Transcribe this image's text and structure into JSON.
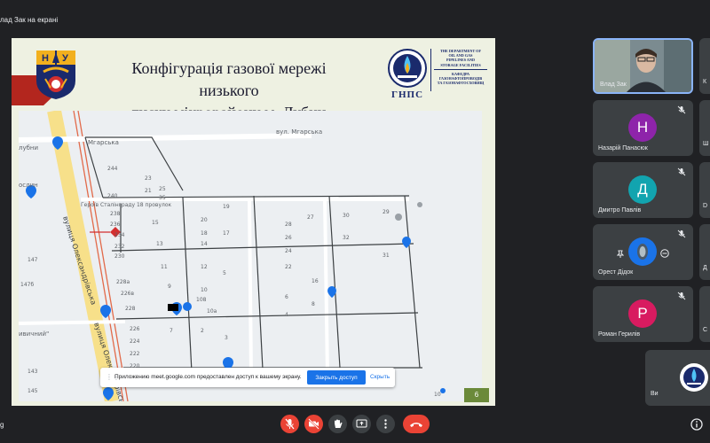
{
  "window": {
    "top_caption": "лад Зак на екрані",
    "bottom_left_text": "g"
  },
  "slide": {
    "title_line1": "Конфігурація газової мережі  низького",
    "title_line2": "тиску мікрорайону м. Лубни",
    "logo_right_label": "ГНПС",
    "dept_lines_en": [
      "THE DEPARTMENT OF",
      "OIL AND GAS",
      "PIPELINES AND",
      "STORAGE FACILITIES"
    ],
    "dept_lines_ua": [
      "КАФЕДРА",
      "ГАЗОНАФТОПРОВОДІВ",
      "ТА ГАЗОНАФТОСХОВИЩ"
    ],
    "page_number": "6",
    "map": {
      "street_mhar_top": "вул. Мгарська",
      "street_mhar_left": "Мгарська",
      "street_olek_1": "вулиця Олександрівська",
      "street_olek_2": "вулиця Олександрівська",
      "street_small": "Героїв Сталінграду 18 провулок",
      "place_lubny": "лубни",
      "place_roslyn": "ослин",
      "place_shop": "ивичний\"",
      "house_numbers": {
        "n244": "244",
        "n240": "240",
        "n238": "238",
        "n236": "236",
        "n234": "234",
        "n232": "232",
        "n230": "230",
        "n228a": "228а",
        "n226b": "226в",
        "n228": "228",
        "n226": "226",
        "n224": "224",
        "n222": "222",
        "n220": "220",
        "n218": "218",
        "n147": "147",
        "n147b": "147б",
        "n145": "145",
        "n143": "143",
        "n23": "23",
        "n21": "21",
        "n25": "25",
        "n35": "35",
        "n15": "15",
        "n13": "13",
        "n11": "11",
        "n9": "9",
        "n7": "7",
        "n20": "20",
        "n19": "19",
        "n18": "18",
        "n17": "17",
        "n14": "14",
        "n12": "12",
        "n10": "10",
        "n10a": "10а",
        "n5": "5",
        "n3": "3",
        "n2": "2",
        "n4": "4",
        "n6": "6",
        "n8": "8",
        "n28": "28",
        "n27": "27",
        "n26": "26",
        "n24": "24",
        "n22": "22",
        "n16": "16",
        "n29": "29",
        "n30": "30",
        "n32": "32",
        "n31": "31",
        "n108": "108",
        "n10b": "10"
      }
    }
  },
  "share_notice": {
    "message": "Приложению meet.google.com предоставлен доступ к вашему экрану.",
    "stop_label": "Закрыть доступ",
    "hide_label": "Скрыть"
  },
  "participants": [
    {
      "name": "Влад Зак",
      "initial": "",
      "color": ""
    },
    {
      "name": "Назарій Панасюк",
      "initial": "Н",
      "color": "#8e24aa"
    },
    {
      "name": "Дмитро Павлів",
      "initial": "Д",
      "color": "#12a4af"
    },
    {
      "name": "Орест Дідок",
      "initial": "",
      "color": "#1a73e8"
    },
    {
      "name": "Роман Герилів",
      "initial": "Р",
      "color": "#d81b60"
    },
    {
      "name": "Ви",
      "initial": "",
      "color": ""
    }
  ],
  "peek_letters": [
    "К",
    "Ш",
    "D",
    "Д",
    "С"
  ],
  "colors": {
    "end_call": "#ea4335",
    "accent": "#1a73e8",
    "tile_bg": "#3c4043"
  }
}
